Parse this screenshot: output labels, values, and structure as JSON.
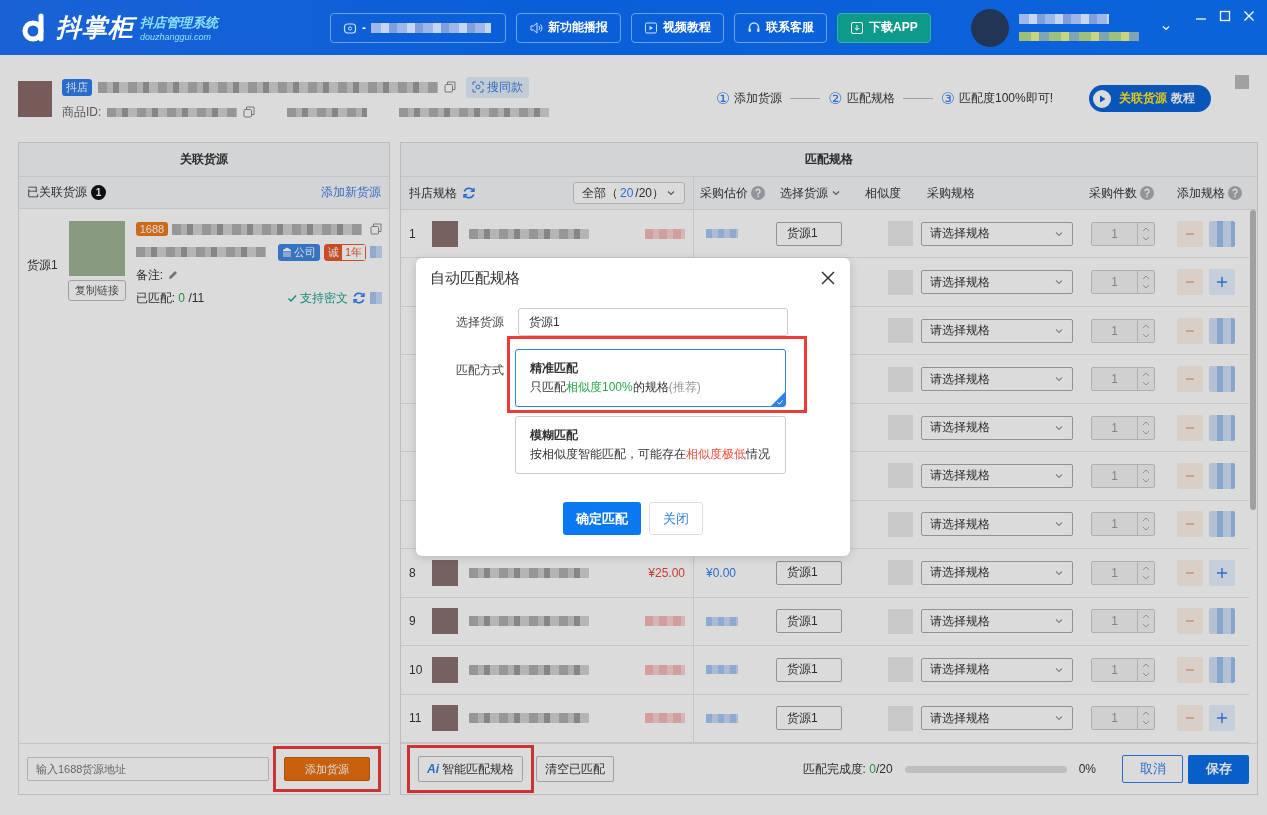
{
  "title_bar": {
    "logo_name": "抖掌柜",
    "logo_subtitle": "抖店管理系统",
    "logo_domain": "douzhanggui.com",
    "shop_prefix": "-",
    "buttons": [
      {
        "label": "新功能播报",
        "kind": "speaker"
      },
      {
        "label": "视频教程",
        "kind": "video"
      },
      {
        "label": "联系客服",
        "kind": "headset"
      },
      {
        "label": "下载APP",
        "kind": "download"
      }
    ]
  },
  "product": {
    "platform": "抖店",
    "similar_button": "搜同款",
    "id_label": "商品ID:"
  },
  "steps": [
    {
      "number": "①",
      "label": "添加货源"
    },
    {
      "number": "②",
      "label": "匹配规格"
    },
    {
      "number": "③",
      "label": "匹配度100%即可!"
    }
  ],
  "tutorial_button": {
    "highlight": "关联货源",
    "rest": "教程"
  },
  "left_panel": {
    "title": "关联货源",
    "linked_label": "已关联货源",
    "linked_count": "1",
    "add_link": "添加新货源",
    "source": {
      "name": "货源1",
      "copy_button": "复制链接",
      "platform": "1688",
      "company_badge": "公司",
      "integrity_badge": "诚",
      "years_badge": "1年",
      "note_label": "备注:",
      "matched_label": "已匹配:",
      "matched_count": "0",
      "matched_total": "/11",
      "cipher_label": "支持密文"
    },
    "url_placeholder": "输入1688货源地址",
    "add_button": {
      "label": "添加货源",
      "highlighted": true
    }
  },
  "right_panel": {
    "title": "匹配规格",
    "filter": {
      "prefix": "全部（",
      "current": "20",
      "rest": "/20）"
    },
    "columns": [
      {
        "label": "抖店规格",
        "kind": "refresh"
      },
      {
        "label": "采购估价",
        "kind": "help"
      },
      {
        "label": "选择货源",
        "kind": "dropdown"
      },
      {
        "label": "相似度",
        "kind": "plain"
      },
      {
        "label": "采购规格",
        "kind": "plain"
      },
      {
        "label": "采购件数",
        "kind": "help"
      },
      {
        "label": "添加规格",
        "kind": "help"
      }
    ],
    "rows": [
      {
        "index": "1",
        "source": "货源1",
        "spec": "请选择规格",
        "qty": "1",
        "add_button": {
          "kind": "blurred"
        }
      },
      {
        "spec": "请选择规格",
        "qty": "1",
        "add_button": {
          "kind": "plus"
        }
      },
      {
        "spec": "请选择规格",
        "qty": "1",
        "add_button": {
          "kind": "blurred"
        }
      },
      {
        "spec": "请选择规格",
        "qty": "1",
        "add_button": {
          "kind": "blurred"
        }
      },
      {
        "spec": "请选择规格",
        "qty": "1",
        "add_button": {
          "kind": "blurred"
        }
      },
      {
        "spec": "请选择规格",
        "qty": "1",
        "add_button": {
          "kind": "blurred"
        }
      },
      {
        "spec": "请选择规格",
        "qty": "1",
        "add_button": {
          "kind": "blurred"
        }
      },
      {
        "index": "8",
        "price": "¥25.00",
        "estimate": "¥0.00",
        "source": "货源1",
        "spec": "请选择规格",
        "qty": "1",
        "add_button": {
          "kind": "plus"
        }
      },
      {
        "index": "9",
        "source": "货源1",
        "spec": "请选择规格",
        "qty": "1",
        "add_button": {
          "kind": "blurred"
        }
      },
      {
        "index": "10",
        "source": "货源1",
        "spec": "请选择规格",
        "qty": "1",
        "add_button": {
          "kind": "blurred"
        }
      },
      {
        "index": "11",
        "source": "货源1",
        "spec": "请选择规格",
        "qty": "1",
        "add_button": {
          "kind": "plus"
        }
      }
    ],
    "footer": {
      "smart_button": {
        "mark": "Ai",
        "label": "智能匹配规格",
        "highlighted": true
      },
      "clear_button": "清空已匹配",
      "progress_label": "匹配完成度:",
      "progress_done": "0",
      "progress_total": "/20",
      "level": 0,
      "percent": "0%",
      "cancel": "取消",
      "save": "保存"
    }
  },
  "dialog": {
    "title": "自动匹配规格",
    "source_label": "选择货源",
    "source_value": "货源1",
    "mode_label": "匹配方式",
    "options": [
      {
        "title": "精准匹配",
        "selected": true,
        "highlighted": true,
        "parts": [
          {
            "text": "只匹配",
            "kind": "normal"
          },
          {
            "text": "相似度100%",
            "kind": "good"
          },
          {
            "text": "的规格",
            "kind": "normal"
          },
          {
            "text": "(推荐)",
            "kind": "hint"
          }
        ]
      },
      {
        "title": "模糊匹配",
        "selected": false,
        "highlighted": false,
        "parts": [
          {
            "text": "按相似度智能匹配，可能存在",
            "kind": "normal"
          },
          {
            "text": "相似度极低",
            "kind": "warning"
          },
          {
            "text": "情况",
            "kind": "normal"
          }
        ]
      }
    ],
    "confirm": "确定匹配",
    "close": "关闭"
  }
}
